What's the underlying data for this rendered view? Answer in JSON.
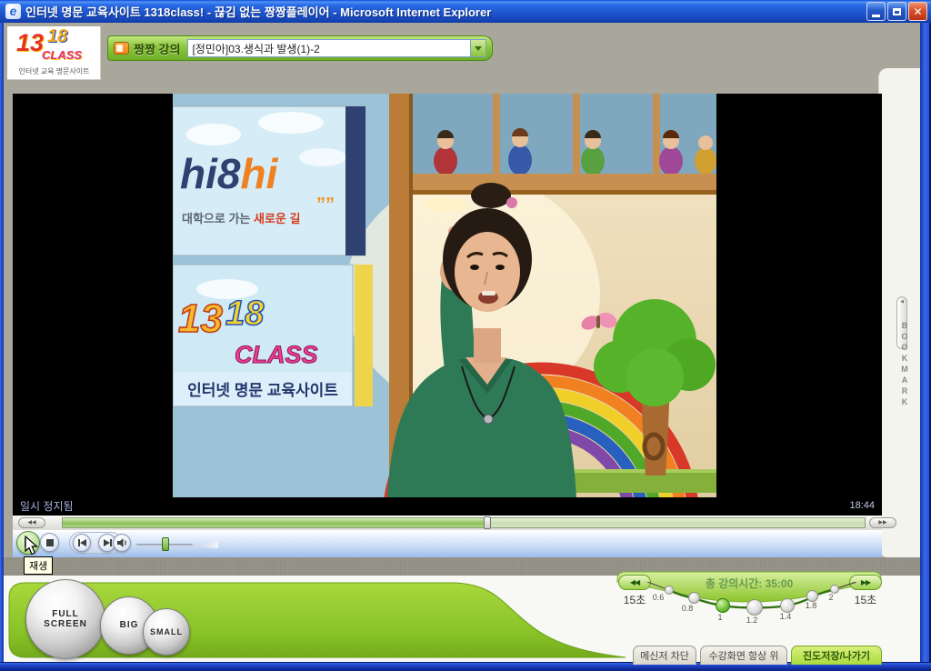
{
  "window": {
    "title": "인터넷 명문 교육사이트 1318class! - 끊김 없는 짱짱플레이어 - Microsoft Internet Explorer",
    "buttons": {
      "close": "✕"
    }
  },
  "header": {
    "logo": {
      "part1": "13",
      "part2": "18",
      "part3": "CLASS",
      "tagline": "인터넷 교육 명문사이트"
    },
    "course_label": "짱짱 강의",
    "dropdown_value": "[정민아]03.생식과 발생(1)-2"
  },
  "video": {
    "signs": {
      "highi_dark": "hi8",
      "highi_orange": "hi",
      "slogan_prefix": "대학으로 가는 ",
      "slogan_highlight": "새로운 길",
      "slogan_quote": "””",
      "brand_num1": "13",
      "brand_num2": "18",
      "brand_class": "CLASS",
      "brand_tagline": "인터넷 명문 교육사이트"
    },
    "status": {
      "state": "일시 정지됨",
      "time": "18:44"
    }
  },
  "seekbar": {
    "rewind": "◀◀",
    "forward": "▶▶",
    "progress_percent": 53
  },
  "controls": {
    "tooltip": "재생",
    "volume_percent": 45
  },
  "bookmark": {
    "label": "BOOKMARK",
    "handle_icon": "◀"
  },
  "bottom": {
    "size_buttons": [
      {
        "label": "FULL SCREEN"
      },
      {
        "label": "BIG"
      },
      {
        "label": "SMALL"
      }
    ],
    "speed": {
      "total_label": "총 강의시간: 35:00",
      "back_icon": "◀◀",
      "fwd_icon": "▶▶",
      "rewind_step": "15초",
      "forward_step": "15초",
      "scale": [
        "0.6",
        "0.8",
        "1",
        "1.2",
        "1.4",
        "1.8",
        "2"
      ],
      "active_value": "1"
    },
    "tabs": [
      {
        "label": "메신저 차단"
      },
      {
        "label": "수강화면 항상 위"
      },
      {
        "label": "진도저장/나가기"
      }
    ]
  }
}
